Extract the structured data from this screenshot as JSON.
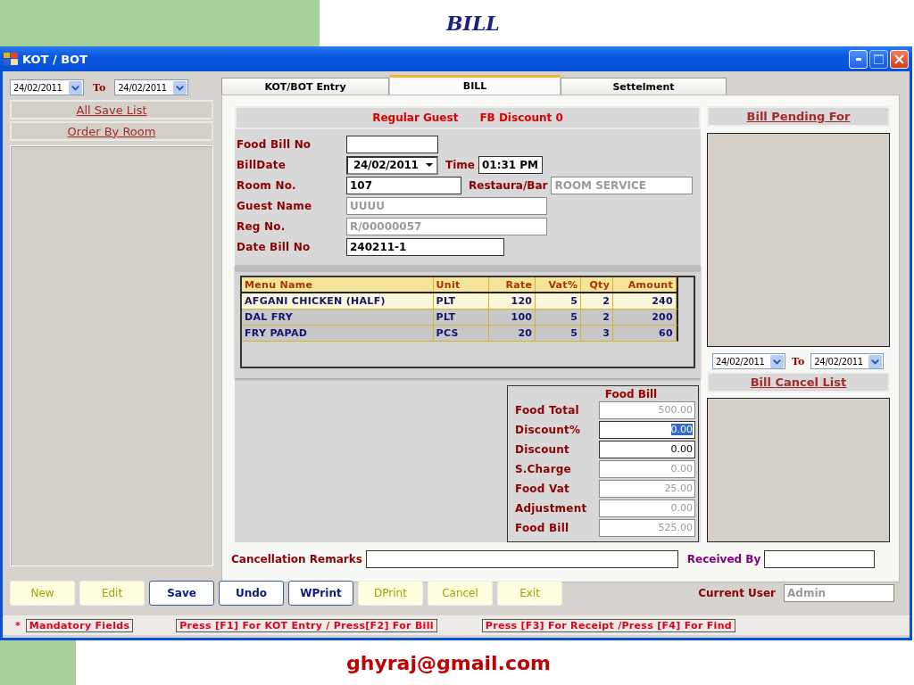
{
  "slide": {
    "title": "BILL",
    "footer": "ghyraj@gmail.com"
  },
  "window": {
    "title": "KOT / BOT"
  },
  "left_panel": {
    "from_date": "24/02/2011",
    "to_label": "To",
    "to_date": "24/02/2011",
    "links": [
      "All Save List",
      "Order By Room"
    ]
  },
  "tabs": [
    {
      "label": "KOT/BOT Entry",
      "selected": false
    },
    {
      "label": "BILL",
      "selected": true
    },
    {
      "label": "Settelment",
      "selected": false
    }
  ],
  "guest_info": [
    "Regular Guest",
    "FB Discount 0"
  ],
  "form_rows": [
    [
      {
        "label": "Food Bill No",
        "kind": "text",
        "disabled": false
      }
    ],
    [
      {
        "label": "BillDate",
        "value": "24/02/2011",
        "kind": "date",
        "disabled": false
      },
      {
        "label": "Time",
        "value": "01:31 PM",
        "kind": "text",
        "disabled": false
      }
    ],
    [
      {
        "label": "Room No.",
        "value": "107",
        "kind": "text",
        "disabled": false
      },
      {
        "label": "Restaura/Bar",
        "value": "ROOM SERVICE",
        "kind": "text",
        "disabled": true
      }
    ],
    [
      {
        "label": "Guest Name",
        "value": "UUUU",
        "kind": "text",
        "disabled": true
      }
    ],
    [
      {
        "label": "Reg No.",
        "value": "R/00000057",
        "kind": "text",
        "disabled": true
      }
    ],
    [
      {
        "label": "Date Bill No",
        "value": "240211-1",
        "kind": "text",
        "disabled": false
      }
    ]
  ],
  "table": {
    "columns": [
      "Menu Name",
      "Unit",
      "Rate",
      "Vat%",
      "Qty",
      "Amount"
    ],
    "rows": [
      {
        "cells": [
          "AFGANI CHICKEN (HALF)",
          "PLT",
          "120",
          "5",
          "2",
          "240"
        ],
        "selected": true
      },
      {
        "cells": [
          "DAL FRY",
          "PLT",
          "100",
          "5",
          "2",
          "200"
        ],
        "selected": false
      },
      {
        "cells": [
          "FRY PAPAD",
          "PCS",
          "20",
          "5",
          "3",
          "60"
        ],
        "selected": false
      }
    ]
  },
  "food_bill": {
    "title": "Food Bill",
    "rows": [
      {
        "label": "Food Total",
        "value": "500.00",
        "disabled": true,
        "highlighted": false
      },
      {
        "label": "Discount%",
        "value": "0.00",
        "disabled": false,
        "highlighted": true
      },
      {
        "label": "Discount",
        "value": "0.00",
        "disabled": false,
        "highlighted": false
      },
      {
        "label": "S.Charge",
        "value": "0.00",
        "disabled": true,
        "highlighted": false
      },
      {
        "label": "Food Vat",
        "value": "25.00",
        "disabled": true,
        "highlighted": false
      },
      {
        "label": "Adjustment",
        "value": "0.00",
        "disabled": true,
        "highlighted": false
      },
      {
        "label": "Food Bill",
        "value": "525.00",
        "disabled": true,
        "highlighted": false
      }
    ]
  },
  "right_panel": {
    "pending_title": "Bill Pending For",
    "from_date": "24/02/2011",
    "to_label": "To",
    "to_date": "24/02/2011",
    "cancel_title": "Bill Cancel List"
  },
  "remarks": {
    "label": "Cancellation Remarks",
    "received_label": "Received By"
  },
  "buttons": [
    {
      "label": "New",
      "disabled": true
    },
    {
      "label": "Edit",
      "disabled": true
    },
    {
      "label": "Save",
      "disabled": false
    },
    {
      "label": "Undo",
      "disabled": false
    },
    {
      "label": "WPrint",
      "disabled": false
    },
    {
      "label": "DPrint",
      "disabled": true
    },
    {
      "label": "Cancel",
      "disabled": true
    },
    {
      "label": "Exit",
      "disabled": true
    }
  ],
  "current_user": {
    "label": "Current User",
    "value": "Admin"
  },
  "status_bar": {
    "mark": "*",
    "items": [
      "Mandatory Fields",
      "Press [F1] For KOT Entry / Press[F2] For Bill",
      "Press [F3] For Receipt /Press [F4] For Find"
    ]
  }
}
